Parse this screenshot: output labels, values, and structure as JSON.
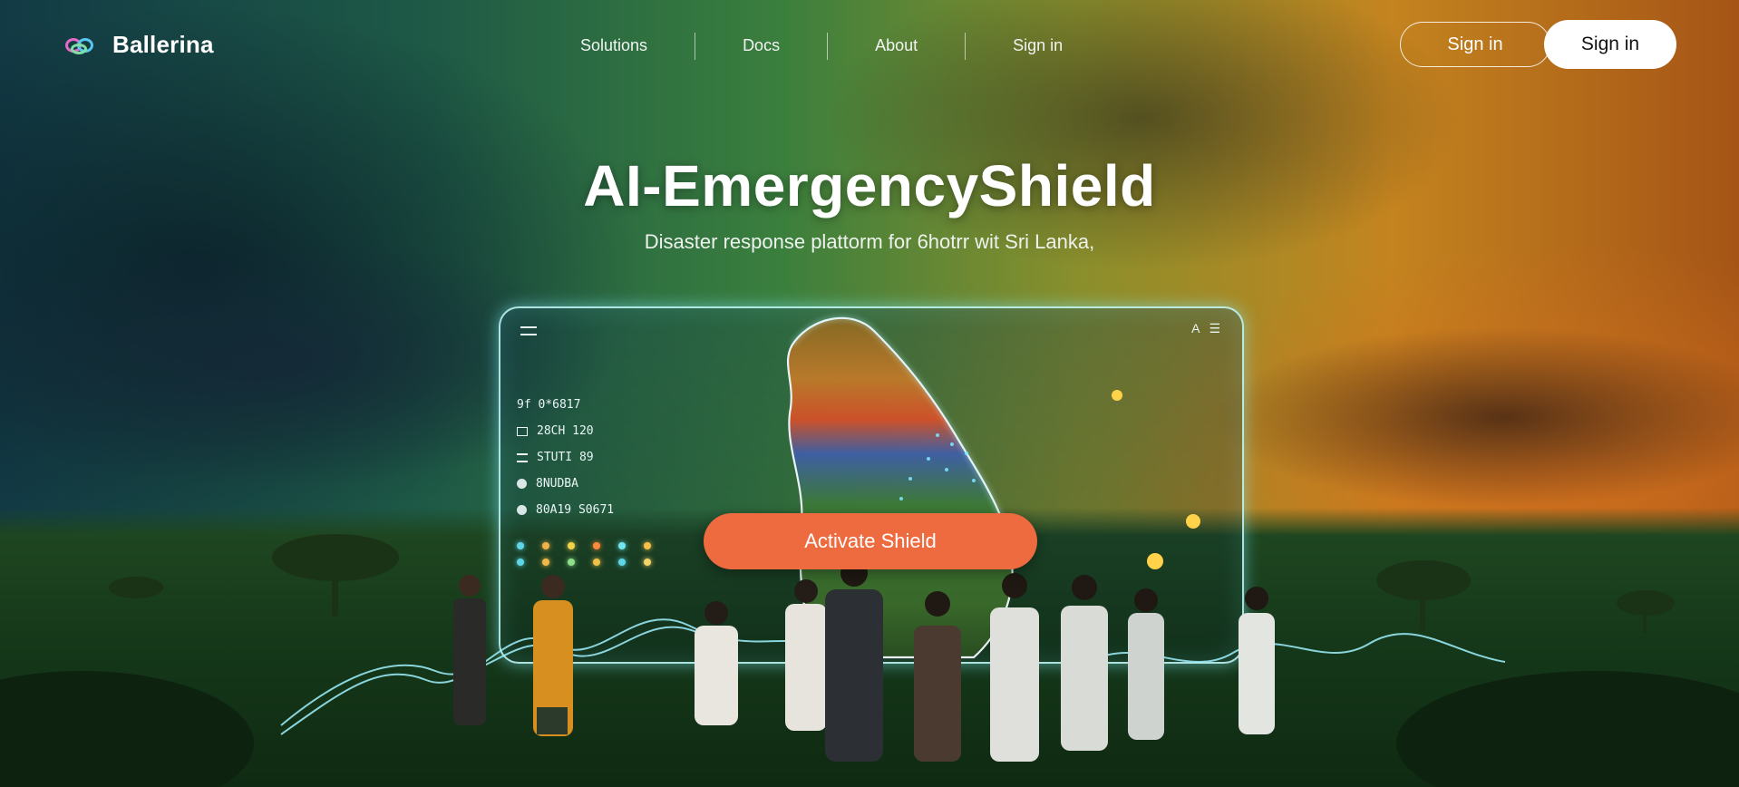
{
  "brand": {
    "name": "Ballerina",
    "logo_icon": "interlocking-rings-logo-icon"
  },
  "nav": {
    "links": [
      {
        "label": "Solutions"
      },
      {
        "label": "Docs"
      },
      {
        "label": "About"
      },
      {
        "label": "Sign in"
      }
    ],
    "sign_in_outline": "Sign in",
    "sign_in_solid": "Sign in"
  },
  "hero": {
    "title": "AI-EmergencyShield",
    "subtitle": "Disaster response plattorm for 6hotrr wit Sri Lanka,"
  },
  "dashboard": {
    "menu_icon": "hamburger-icon",
    "tools": [
      "A",
      "☰"
    ],
    "rows": [
      {
        "icon": "prefix-text",
        "text": "9f 0*6817"
      },
      {
        "icon": "square-icon",
        "text": "28CH 120"
      },
      {
        "icon": "bars-icon",
        "text": "STUTI 89"
      },
      {
        "icon": "dot-icon",
        "text": "8NUDBA"
      },
      {
        "icon": "dot-icon",
        "text": "80A19 S0671"
      }
    ],
    "legend_colors": [
      "#5ed6e6",
      "#f2b24a",
      "#f2d24a",
      "#ff8a3d",
      "#6fe6f2",
      "#f6c04a",
      "#5ed6e6",
      "#f0b84a",
      "#8fe08a",
      "#f2c04a",
      "#5ed6e6",
      "#f5d36a"
    ],
    "map_label": "Sri Lanka"
  },
  "cta": {
    "label": "Activate Shield"
  },
  "colors": {
    "cta": "#ee6a3f",
    "glow": "#9ff1ff",
    "hotspot": "#ffd24a"
  }
}
